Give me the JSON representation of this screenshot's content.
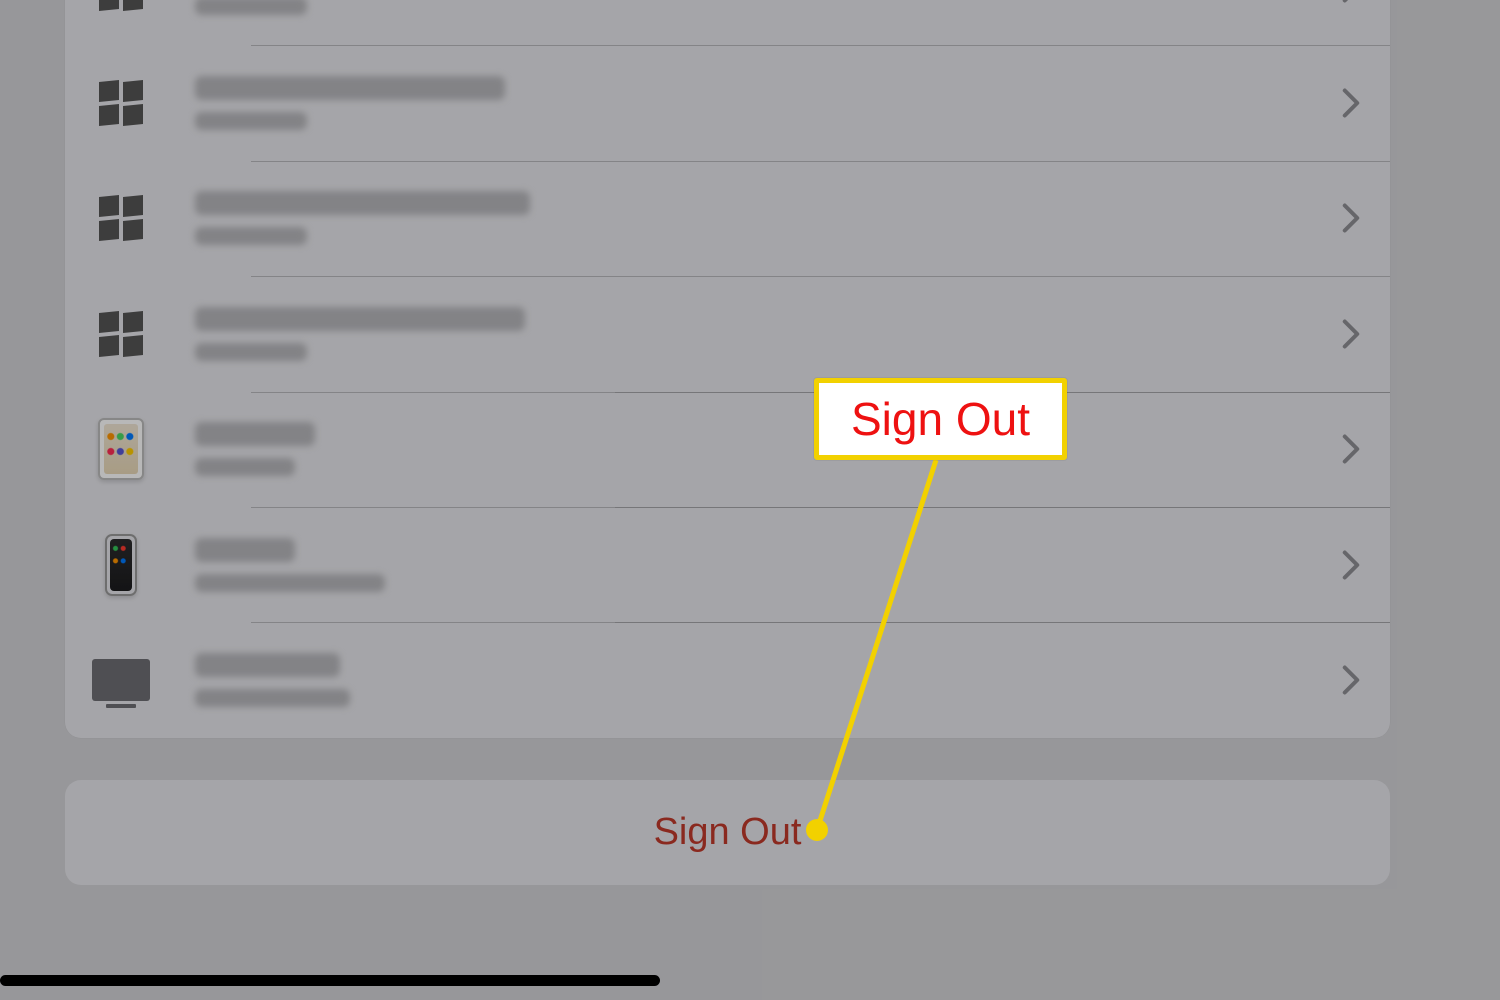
{
  "signout_label": "Sign Out",
  "callout_label": "Sign Out",
  "devices": [
    {
      "type": "windows"
    },
    {
      "type": "windows"
    },
    {
      "type": "windows"
    },
    {
      "type": "ipad"
    },
    {
      "type": "iphone"
    },
    {
      "type": "tv"
    }
  ]
}
